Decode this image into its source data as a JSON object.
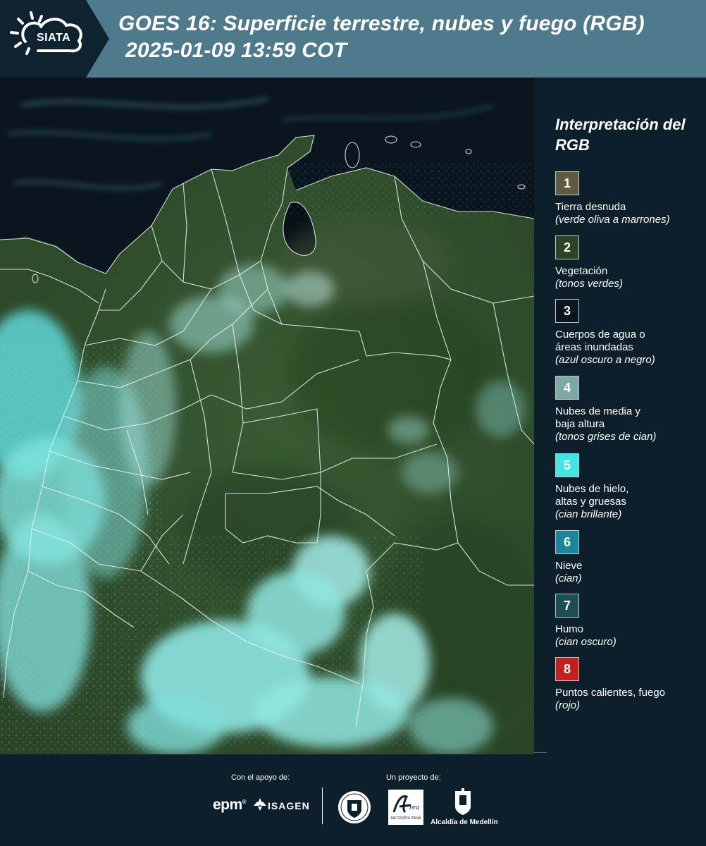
{
  "header": {
    "logo_text": "SIATA",
    "title_line1": "GOES 16: Superficie terrestre, nubes y fuego (RGB)",
    "title_line2": "2025-01-09 13:59 COT"
  },
  "legend": {
    "title": "Interpretación del RGB",
    "items": [
      {
        "num": "1",
        "label": "Tierra desnuda",
        "sub": "(verde oliva a marrones)",
        "color": "#5d5a3f"
      },
      {
        "num": "2",
        "label": "Vegetación",
        "sub": "(tonos verdes)",
        "color": "#2d4425"
      },
      {
        "num": "3",
        "label": "Cuerpos de agua o áreas inundadas",
        "sub": "(azul oscuro a negro)",
        "color": "#0b1520"
      },
      {
        "num": "4",
        "label": "Nubes de media y baja altura",
        "sub": "(tonos grises de cian)",
        "color": "#7ea7a6"
      },
      {
        "num": "5",
        "label": "Nubes de hielo, altas y gruesas",
        "sub": "(cian brillante)",
        "color": "#3fe6e3"
      },
      {
        "num": "6",
        "label": "Nieve",
        "sub": "(cian)",
        "color": "#1b859c"
      },
      {
        "num": "7",
        "label": "Humo",
        "sub": "(cian oscuro)",
        "color": "#1d4d55"
      },
      {
        "num": "8",
        "label": "Puntos calientes, fuego",
        "sub": "(rojo)",
        "color": "#c1201f"
      }
    ]
  },
  "footer": {
    "support_label": "Con el apoyo de:",
    "project_label": "Un proyecto de:",
    "epm": "epm",
    "isagen": "ISAGEN",
    "area_label": "METROPOLITANA",
    "alcaldia": "Alcaldía de Medellín"
  }
}
